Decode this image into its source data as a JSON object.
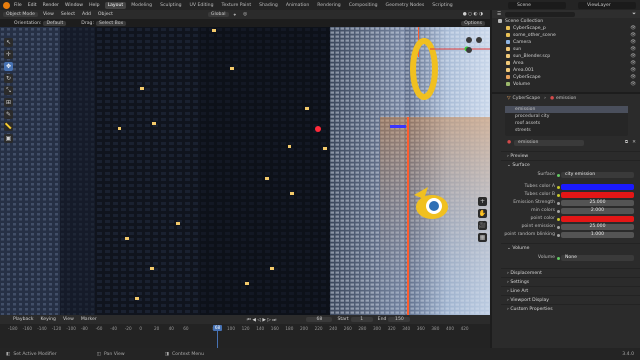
{
  "topbar": {
    "menus": [
      "File",
      "Edit",
      "Render",
      "Window",
      "Help"
    ],
    "workspaces": [
      "Layout",
      "Modeling",
      "Sculpting",
      "UV Editing",
      "Texture Paint",
      "Shading",
      "Animation",
      "Rendering",
      "Compositing",
      "Geometry Nodes",
      "Scripting"
    ],
    "active_workspace": "Layout",
    "scene": "Scene",
    "view_layer": "ViewLayer"
  },
  "viewport_header": {
    "mode": "Object Mode",
    "menus": [
      "View",
      "Select",
      "Add",
      "Object"
    ],
    "transform": "Global",
    "orientation_label": "Orientation:",
    "orientation_value": "Default",
    "drag_label": "Drag:",
    "drag_value": "Select Box",
    "options": "Options"
  },
  "toolbar": {
    "tools": [
      "cursor",
      "select",
      "move",
      "rotate",
      "scale",
      "transform",
      "annotate",
      "measure",
      "add"
    ]
  },
  "timeline": {
    "playback": "Playback",
    "keying": "Keying",
    "view": "View",
    "marker": "Marker",
    "current_frame": "68",
    "start_label": "Start",
    "start": "1",
    "end_label": "End",
    "end": "150",
    "ticks": [
      "-180",
      "-160",
      "-140",
      "-120",
      "-100",
      "-80",
      "-60",
      "-40",
      "-20",
      "0",
      "20",
      "40",
      "60",
      "68",
      "80",
      "100",
      "120",
      "140",
      "160",
      "180",
      "200",
      "220",
      "240",
      "260",
      "280",
      "300",
      "320",
      "340",
      "360",
      "380",
      "400",
      "420"
    ]
  },
  "statusbar": {
    "left": "Set Active Modifier",
    "mid": "Pan View",
    "right": "Context Menu",
    "version": "3.4.0"
  },
  "outliner": {
    "title": "Scene Collection",
    "rows": [
      {
        "label": "Scene Collection",
        "color": "#b9b9b9"
      },
      {
        "label": "CyberScape_p",
        "color": "#e8c056"
      },
      {
        "label": "some_other_scene",
        "color": "#e8c056"
      },
      {
        "label": "Camera",
        "color": "#8fb6e5"
      },
      {
        "label": "sun",
        "color": "#f0c878"
      },
      {
        "label": "sun_Blender.scp",
        "color": "#f0c878"
      },
      {
        "label": "Area",
        "color": "#f0c878"
      },
      {
        "label": "Area.001",
        "color": "#f0c878"
      },
      {
        "label": "CyberScape",
        "color": "#e8a35e"
      },
      {
        "label": "Volume",
        "color": "#9bb86b"
      }
    ]
  },
  "properties": {
    "object": "CyberScape",
    "material": "emission",
    "slots": [
      "emission",
      "procedural city",
      "roof assets",
      "streets"
    ],
    "active_slot": "emission",
    "material_name": "emission",
    "sections": {
      "preview": "Preview",
      "surface": "Surface",
      "volume": "Volume",
      "displacement": "Displacement",
      "settings": "Settings",
      "lineart": "Line Art",
      "viewport_display": "Viewport Display",
      "custom_props": "Custom Properties"
    },
    "surface_label": "Surface",
    "surface_value": "city emission",
    "fields": [
      {
        "label": "Tubes color A",
        "type": "color",
        "color": "#1a1aff"
      },
      {
        "label": "Tubes color B",
        "type": "color",
        "color": "#e41616"
      },
      {
        "label": "Emission Strength",
        "type": "value",
        "value": "25.000"
      },
      {
        "label": "min colors",
        "type": "value",
        "value": "2.000"
      },
      {
        "label": "point color",
        "type": "color",
        "color": "#e41616"
      },
      {
        "label": "point emission",
        "type": "value",
        "value": "25.000"
      },
      {
        "label": "point random blinking",
        "type": "value",
        "value": "1.000"
      }
    ],
    "volume_label": "Volume",
    "volume_value": "None"
  }
}
